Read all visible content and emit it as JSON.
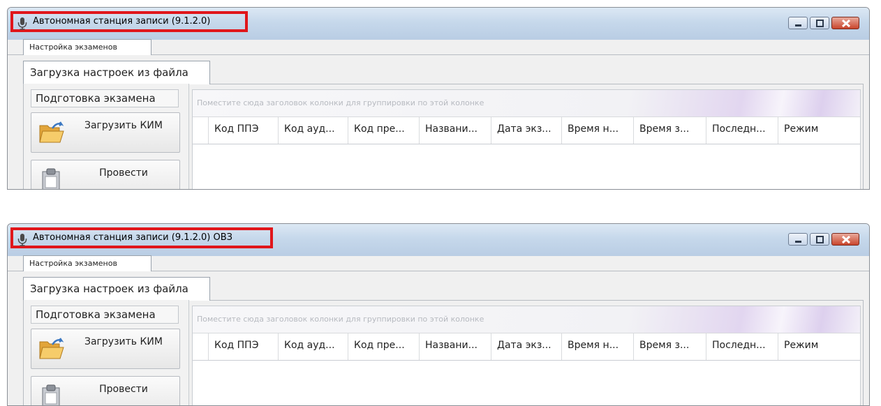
{
  "windows": [
    {
      "title": "Автономная станция записи (9.1.2.0)",
      "top_tab": "Настройка экзаменов",
      "inner_tab": "Загрузка настроек из файла",
      "section_title": "Подготовка экзамена",
      "buttons": [
        {
          "label": "Загрузить КИМ",
          "icon": "folder-open-icon"
        },
        {
          "label": "Провести",
          "icon": "clipboard-icon"
        }
      ],
      "group_hint": "Поместите сюда заголовок колонки для группировки по этой колонке",
      "columns": [
        "Код ППЭ",
        "Код ауд...",
        "Код пре...",
        "Названи...",
        "Дата экз...",
        "Время н...",
        "Время з...",
        "Последн...",
        "Режим"
      ]
    },
    {
      "title": "Автономная станция записи (9.1.2.0) ОВЗ",
      "top_tab": "Настройка экзаменов",
      "inner_tab": "Загрузка настроек из файла",
      "section_title": "Подготовка экзамена",
      "buttons": [
        {
          "label": "Загрузить КИМ",
          "icon": "folder-open-icon"
        },
        {
          "label": "Провести",
          "icon": "clipboard-icon"
        }
      ],
      "group_hint": "Поместите сюда заголовок колонки для группировки по этой колонке",
      "columns": [
        "Код ППЭ",
        "Код ауд...",
        "Код пре...",
        "Названи...",
        "Дата экз...",
        "Время н...",
        "Время з...",
        "Последн...",
        "Режим"
      ]
    }
  ],
  "colors": {
    "highlight": "#e0161b",
    "titlebar": "#c6d8eb",
    "close_button": "#c9452c"
  }
}
